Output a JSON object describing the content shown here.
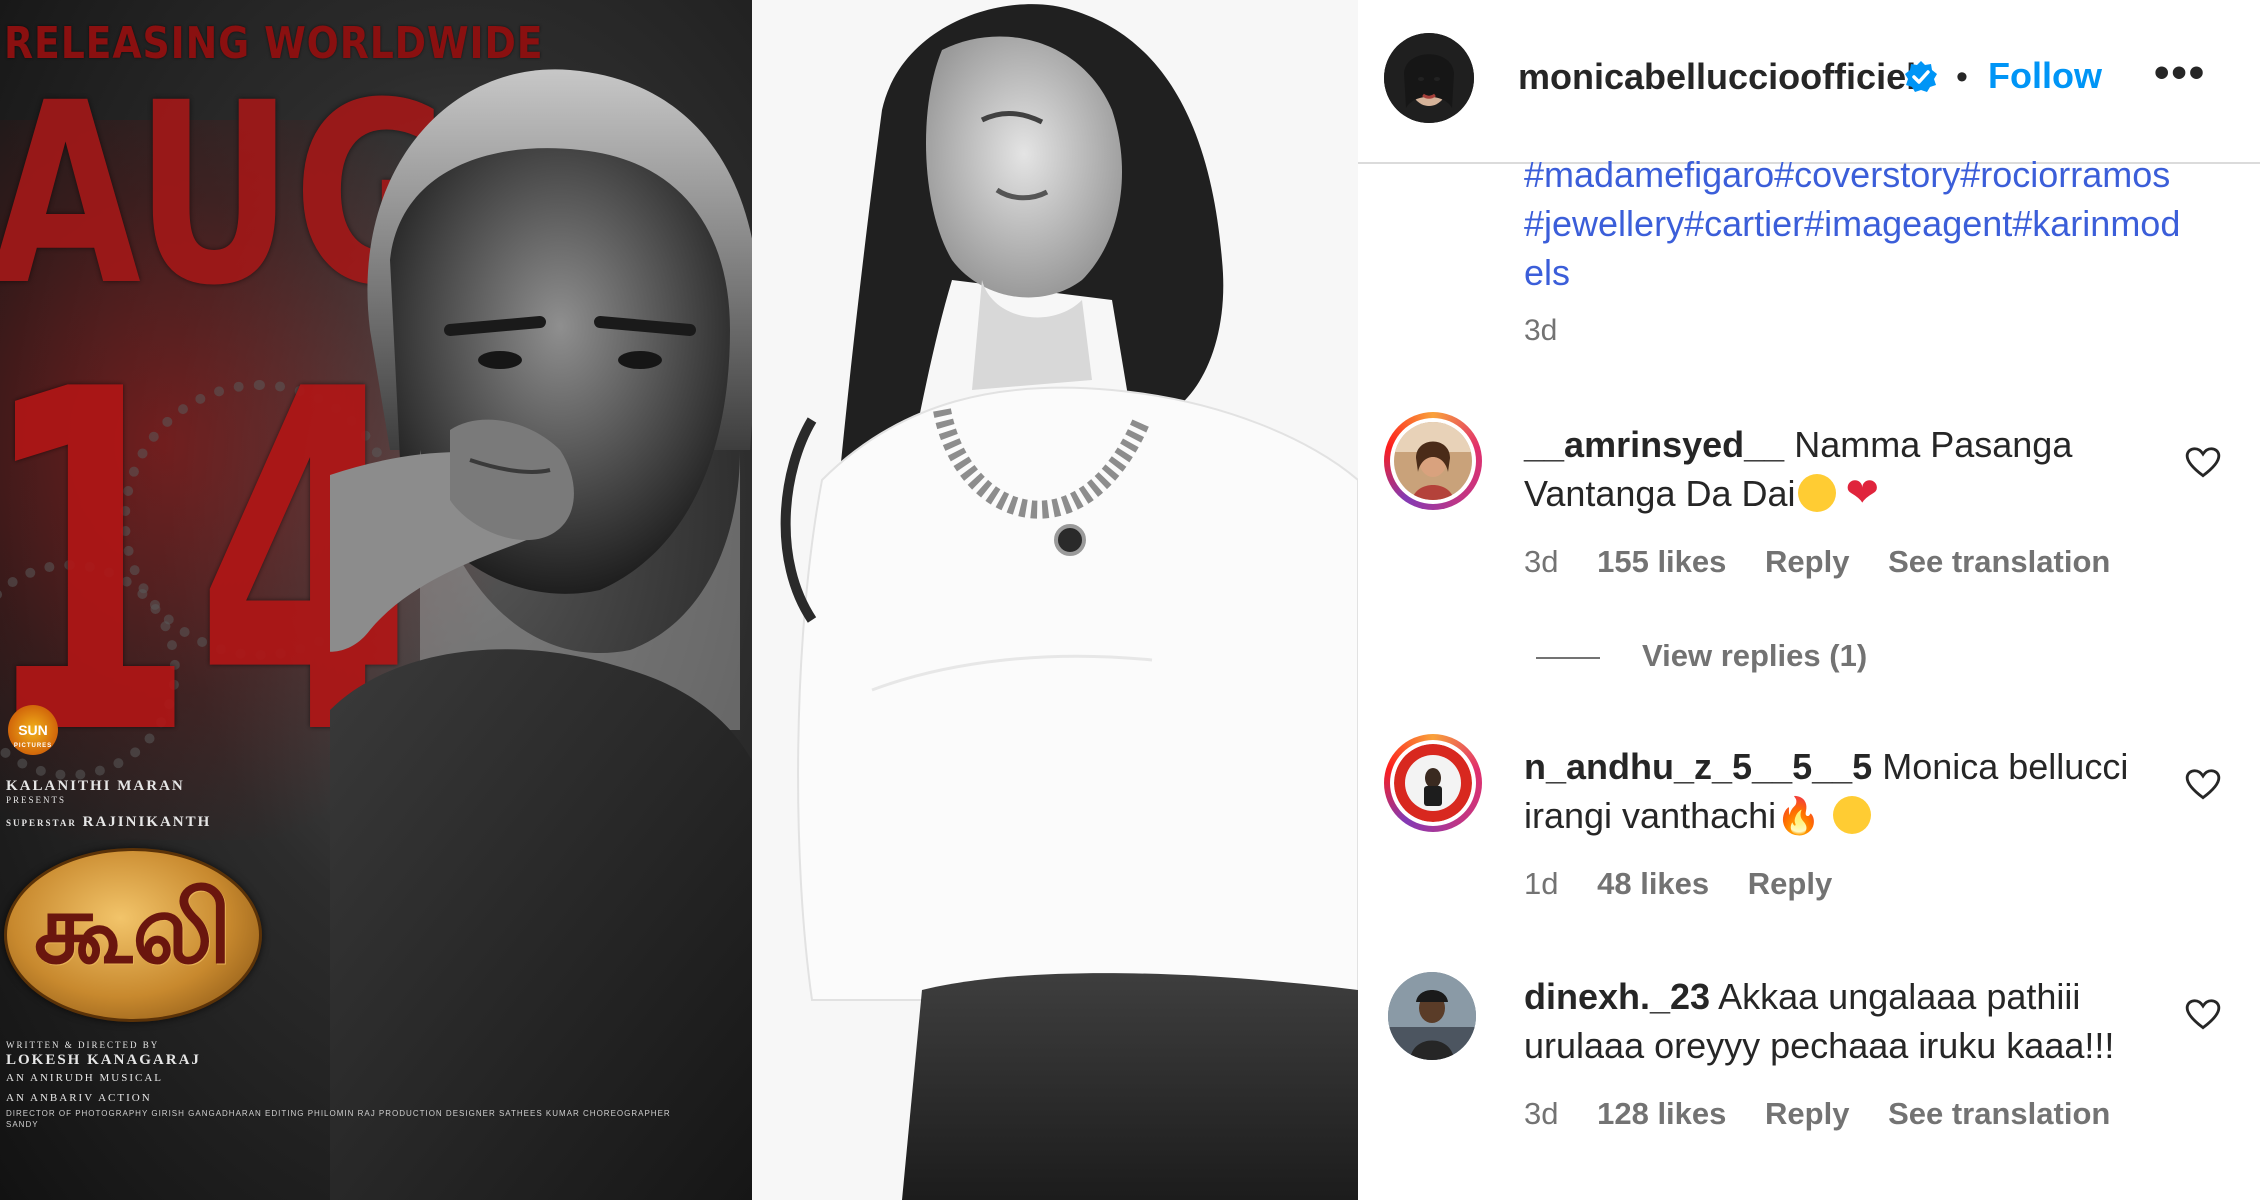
{
  "poster": {
    "release_text": "RELEASING WORLDWIDE",
    "month": "AUG",
    "day": "14",
    "studio_logo": "SUN",
    "studio_logo_sub": "PICTURES",
    "presenter": "KALANITHI MARAN",
    "presents": "PRESENTS",
    "star_prefix": "SUPERSTAR",
    "star": "RAJINIKANTH",
    "title": "கூலி",
    "credit_written": "WRITTEN & DIRECTED BY",
    "director": "LOKESH KANAGARAJ",
    "music": "AN ANIRUDH MUSICAL",
    "action": "AN ANBARIV ACTION",
    "credits_fine": "DIRECTOR OF PHOTOGRAPHY GIRISH GANGADHARAN  EDITING PHILOMIN RAJ  PRODUCTION DESIGNER SATHEES KUMAR  CHOREOGRAPHER SANDY",
    "colors": {
      "red": "#a11818",
      "gold": "#c8892e"
    }
  },
  "panel": {
    "username": "monicabelluccio­fficiel",
    "username_display": "monicabelluccioofficiel",
    "separator": "•",
    "follow_label": "Follow",
    "more_label": "•••",
    "hashtags": "#madamefigaro#coverstory#rociorramos#jewellery#cartier#imageagent#karinmodels",
    "post_time": "3d",
    "view_replies": "View replies (1)",
    "comments": [
      {
        "user": "__amrinsyed__",
        "text": "Namma Pasanga Vantanga Da Dai",
        "emojis": [
          "😂",
          "❤️"
        ],
        "time": "3d",
        "likes": "155 likes",
        "reply": "Reply",
        "translate": "See translation"
      },
      {
        "user": "n_andhu_z_5__5__5",
        "text": "Monica bellucci irangi vanthachi",
        "emojis": [
          "🔥",
          "😁"
        ],
        "time": "1d",
        "likes": "48 likes",
        "reply": "Reply",
        "translate": ""
      },
      {
        "user": "dinexh._23",
        "text": "Akkaa ungalaaa pathiii urulaaa oreyyy pechaaa iruku kaaa!!!",
        "emojis": [],
        "time": "3d",
        "likes": "128 likes",
        "reply": "Reply",
        "translate": "See translation"
      }
    ],
    "colors": {
      "link": "#0095f6",
      "hashtag": "#3b5ed9",
      "muted": "#737373",
      "text": "#262626"
    }
  }
}
